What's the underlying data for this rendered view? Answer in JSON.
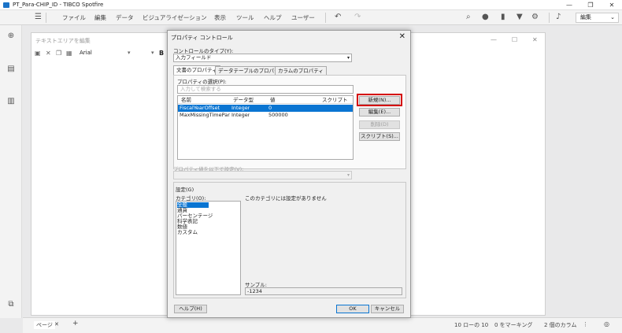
{
  "window": {
    "title": "PT_Para-CHIP_ID - TIBCO Spotfire",
    "controls": [
      "—",
      "❐",
      "✕"
    ]
  },
  "menubar": {
    "items": [
      "ファイル",
      "編集",
      "データ",
      "ビジュアライゼーション",
      "表示",
      "ツール",
      "ヘルプ",
      "ユーザー"
    ],
    "mode_label": "編集"
  },
  "textarea": {
    "title": "テキストエリアを編集",
    "font": "Arial",
    "bold": "B"
  },
  "status": {
    "tab": "ページ",
    "tab_close": "✕",
    "add_tab": "+",
    "rows": "10 ローの 10",
    "marked": "0 をマーキング",
    "columns": "2 個のカラム"
  },
  "dialog": {
    "title": "プロパティ コントロール",
    "close": "✕",
    "control_type_label": "コントロールのタイプ(Y):",
    "control_type_value": "入力フィールド",
    "tabs": [
      "文書のプロパティ",
      "データテーブルのプロパティ",
      "カラムのプロパティ"
    ],
    "select_property_label": "プロパティの選択(P):",
    "search_placeholder": "入力して検索する",
    "columns": [
      "名前",
      "データ型",
      "値",
      "スクリプト"
    ],
    "rows": [
      {
        "name": "FiscalYearOffset",
        "type": "Integer",
        "value": "0",
        "script": ""
      },
      {
        "name": "MaxMissingTimePar...",
        "type": "Integer",
        "value": "500000",
        "script": ""
      }
    ],
    "buttons": {
      "new": "新規(N)...",
      "edit": "編集(E)...",
      "delete": "削除(D)",
      "script": "スクリプト(S)..."
    },
    "set_value_label": "プロパティ値を以下で設定(V):",
    "settings_label": "設定(G)",
    "category_label": "カテゴリ(O):",
    "categories": [
      "全般",
      "通貨",
      "パーセンテージ",
      "科学表記",
      "数値",
      "カスタム"
    ],
    "no_settings_text": "このカテゴリには設定がありません",
    "sample_label": "サンプル:",
    "sample_value": "-1234",
    "help": "ヘルプ(H)",
    "ok": "OK",
    "cancel": "キャンセル"
  },
  "colors": {
    "selection": "#0a75d2",
    "highlight": "#d40000"
  }
}
